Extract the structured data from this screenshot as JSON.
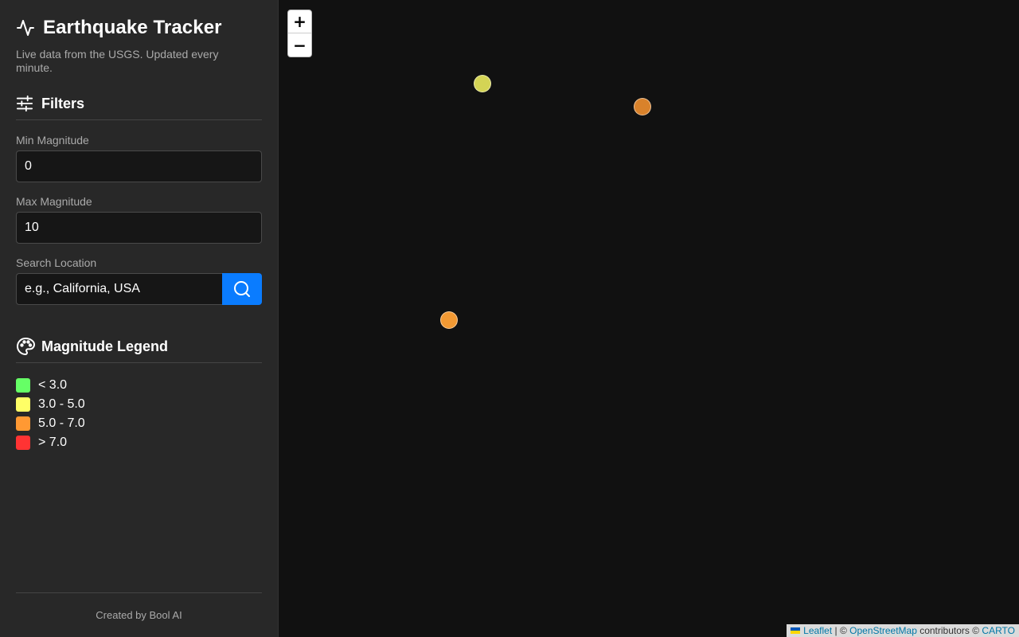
{
  "app": {
    "title": "Earthquake Tracker",
    "subtitle": "Live data from the USGS. Updated every minute.",
    "logo_icon": "activity-pulse-icon"
  },
  "filters": {
    "title": "Filters",
    "icon": "sliders-icon",
    "min_magnitude": {
      "label": "Min Magnitude",
      "value": "0"
    },
    "max_magnitude": {
      "label": "Max Magnitude",
      "value": "10"
    },
    "search": {
      "label": "Search Location",
      "placeholder": "e.g., California, USA",
      "button_icon": "search-icon"
    }
  },
  "legend": {
    "title": "Magnitude Legend",
    "icon": "palette-icon",
    "items": [
      {
        "label": "< 3.0",
        "color": "#66ff66"
      },
      {
        "label": "3.0 - 5.0",
        "color": "#ffff66"
      },
      {
        "label": "5.0 - 7.0",
        "color": "#ff9933"
      },
      {
        "label": "> 7.0",
        "color": "#ff3333"
      }
    ]
  },
  "footer": {
    "text": "Created by Bool AI"
  },
  "map": {
    "zoom_in": "+",
    "zoom_out": "−",
    "markers": [
      {
        "color": "#d4d455"
      },
      {
        "color": "#d9822b"
      },
      {
        "color": "#f29933"
      }
    ],
    "attribution": {
      "leaflet": "Leaflet",
      "sep1": " | © ",
      "osm": "OpenStreetMap",
      "contrib": " contributors © ",
      "carto": "CARTO"
    }
  }
}
